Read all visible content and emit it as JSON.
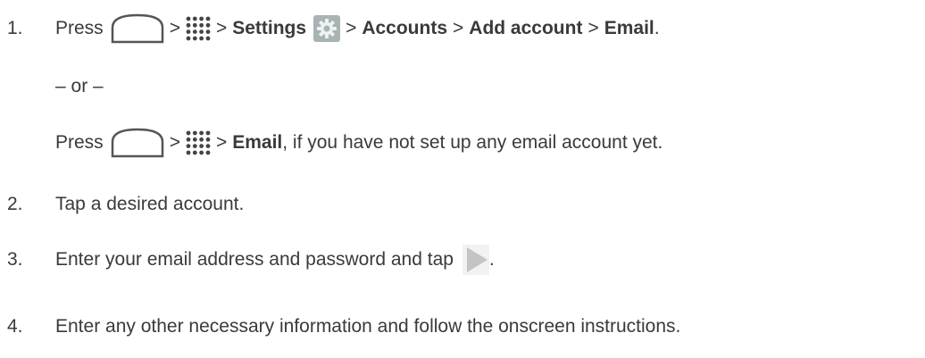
{
  "steps": [
    {
      "number": "1.",
      "press": "Press",
      "gt": ">",
      "settings": "Settings",
      "accounts": "Accounts",
      "add_account": "Add account",
      "email": "Email",
      "period": "."
    },
    {
      "or": "– or –"
    },
    {
      "press": "Press",
      "gt": ">",
      "email": "Email",
      "suffix": ", if you have not set up any email account yet."
    },
    {
      "number": "2.",
      "text": "Tap a desired account."
    },
    {
      "number": "3.",
      "text": "Enter your email address and password and tap",
      "period": "."
    },
    {
      "number": "4.",
      "text": "Enter any other necessary information and follow the onscreen instructions."
    }
  ],
  "icons": {
    "home": "home-icon",
    "apps": "apps-icon",
    "settings": "settings-icon",
    "next": "next-arrow-icon"
  }
}
